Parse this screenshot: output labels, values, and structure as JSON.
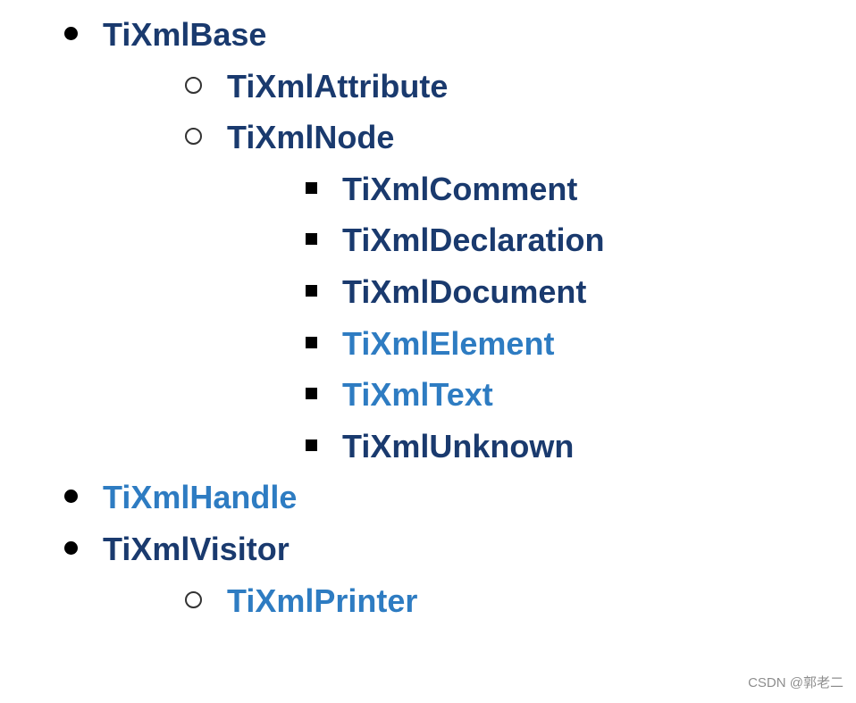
{
  "tree": {
    "items": [
      {
        "label": "TiXmlBase",
        "style": "dark"
      },
      {
        "label": "TiXmlHandle",
        "style": "light"
      },
      {
        "label": "TiXmlVisitor",
        "style": "dark"
      }
    ],
    "base_children": [
      {
        "label": "TiXmlAttribute",
        "style": "dark"
      },
      {
        "label": "TiXmlNode",
        "style": "dark"
      }
    ],
    "node_children": [
      {
        "label": "TiXmlComment",
        "style": "dark"
      },
      {
        "label": "TiXmlDeclaration",
        "style": "dark"
      },
      {
        "label": "TiXmlDocument",
        "style": "dark"
      },
      {
        "label": "TiXmlElement",
        "style": "light"
      },
      {
        "label": "TiXmlText",
        "style": "light"
      },
      {
        "label": "TiXmlUnknown",
        "style": "dark"
      }
    ],
    "visitor_children": [
      {
        "label": "TiXmlPrinter",
        "style": "light"
      }
    ]
  },
  "colors": {
    "dark": "#1a3a6e",
    "light": "#2e7cc2"
  },
  "watermark": "CSDN @郭老二"
}
